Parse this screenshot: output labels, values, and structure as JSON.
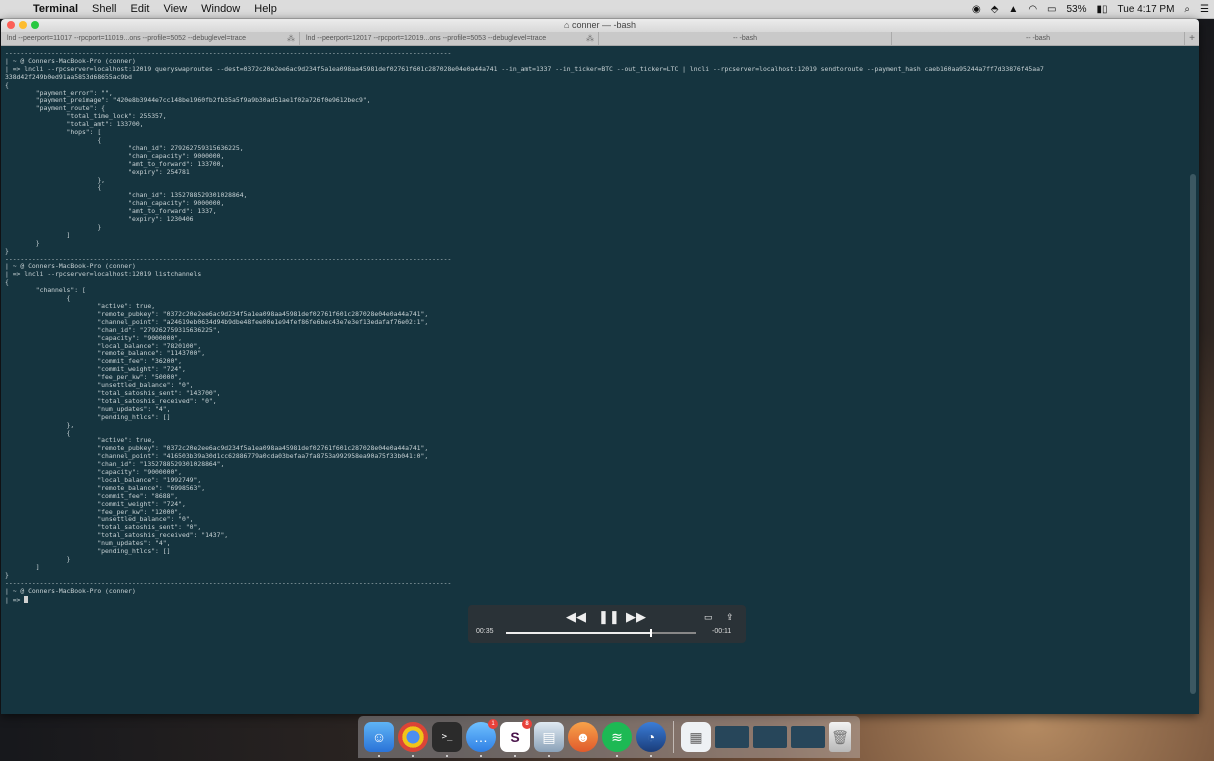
{
  "menubar": {
    "app": "Terminal",
    "items": [
      "Shell",
      "Edit",
      "View",
      "Window",
      "Help"
    ],
    "battery": "53%",
    "clock": "Tue 4:17 PM"
  },
  "window": {
    "title": "conner — -bash",
    "tabs": [
      "lnd --peerport=11017 --rpcport=11019...ons --profile=5052 --debuglevel=trace",
      "lnd --peerport=12017 --rpcport=12019...ons --profile=5053 --debuglevel=trace",
      "-- -bash",
      "-- -bash"
    ]
  },
  "terminal": {
    "lines": [
      "--------------------------------------------------------------------------------------------------------------------",
      "| ~ @ Conners-MacBook-Pro (conner)",
      "| => lncli --rpcserver=localhost:12019 queryswaproutes --dest=0372c20e2ee6ac9d234f5a1ea098aa45981def02761f601c287028e04e0a44a741 --in_amt=1337 --in_ticker=BTC --out_ticker=LTC | lncli --rpcserver=localhost:12019 sendtoroute --payment_hash caeb160aa95244a7ff7d33876f45aa7",
      "338d42f249b0ed91aa5853d68655ac9bd",
      "{",
      "        \"payment_error\": \"\",",
      "        \"payment_preimage\": \"420e8b3944e7cc148be1960fb2fb35a5f9a9b30ad51ae1f02a726f0e9612bec9\",",
      "        \"payment_route\": {",
      "                \"total_time_lock\": 255357,",
      "                \"total_amt\": 133700,",
      "                \"hops\": [",
      "                        {",
      "                                \"chan_id\": 279262759315636225,",
      "                                \"chan_capacity\": 9000000,",
      "                                \"amt_to_forward\": 133700,",
      "                                \"expiry\": 254781",
      "                        },",
      "                        {",
      "                                \"chan_id\": 1352788529301028864,",
      "                                \"chan_capacity\": 9000000,",
      "                                \"amt_to_forward\": 1337,",
      "                                \"expiry\": 1230406",
      "                        }",
      "                ]",
      "        }",
      "}",
      "--------------------------------------------------------------------------------------------------------------------",
      "| ~ @ Conners-MacBook-Pro (conner)",
      "| => lncli --rpcserver=localhost:12019 listchannels",
      "{",
      "        \"channels\": [",
      "                {",
      "                        \"active\": true,",
      "                        \"remote_pubkey\": \"0372c20e2ee6ac9d234f5a1ea098aa45981def02761f601c287028e04e0a44a741\",",
      "                        \"channel_point\": \"a24619eb0634d94b9dbe48fee00e1e94fef86fe6bec43e7e3ef13edafaf76e02:1\",",
      "                        \"chan_id\": \"279262759315636225\",",
      "                        \"capacity\": \"9000000\",",
      "                        \"local_balance\": \"7820100\",",
      "                        \"remote_balance\": \"1143700\",",
      "                        \"commit_fee\": \"36200\",",
      "                        \"commit_weight\": \"724\",",
      "                        \"fee_per_kw\": \"50000\",",
      "                        \"unsettled_balance\": \"0\",",
      "                        \"total_satoshis_sent\": \"143700\",",
      "                        \"total_satoshis_received\": \"0\",",
      "                        \"num_updates\": \"4\",",
      "                        \"pending_htlcs\": []",
      "                },",
      "                {",
      "                        \"active\": true,",
      "                        \"remote_pubkey\": \"0372c20e2ee6ac9d234f5a1ea098aa45981def02761f601c287028e04e0a44a741\",",
      "                        \"channel_point\": \"416503b39a30d1cc62886779a0cda03befaa7fa8753a992958ea90a75f33b041:0\",",
      "                        \"chan_id\": \"1352788529301028864\",",
      "                        \"capacity\": \"9000000\",",
      "                        \"local_balance\": \"1992749\",",
      "                        \"remote_balance\": \"6998563\",",
      "                        \"commit_fee\": \"8688\",",
      "                        \"commit_weight\": \"724\",",
      "                        \"fee_per_kw\": \"12000\",",
      "                        \"unsettled_balance\": \"0\",",
      "                        \"total_satoshis_sent\": \"0\",",
      "                        \"total_satoshis_received\": \"1437\",",
      "                        \"num_updates\": \"4\",",
      "                        \"pending_htlcs\": []",
      "                }",
      "        ]",
      "}",
      "--------------------------------------------------------------------------------------------------------------------",
      "| ~ @ Conners-MacBook-Pro (conner)",
      "| => "
    ]
  },
  "video": {
    "elapsed": "00:35",
    "remaining": "-00:11",
    "progress_fraction": 0.76
  },
  "dock": {
    "badges": {
      "mail": "1",
      "slack": "8"
    }
  }
}
